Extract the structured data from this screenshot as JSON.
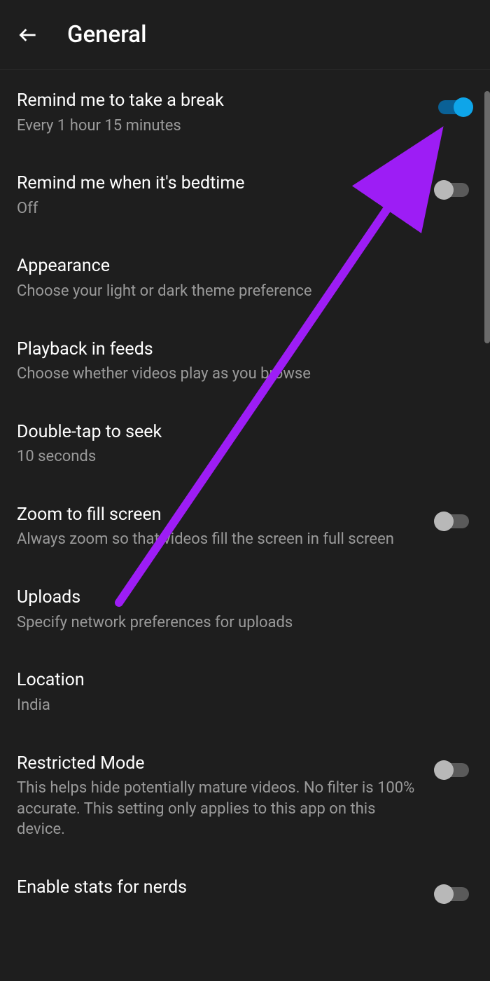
{
  "header": {
    "title": "General"
  },
  "settings": [
    {
      "title": "Remind me to take a break",
      "subtitle": "Every 1 hour 15 minutes",
      "toggle": "on"
    },
    {
      "title": "Remind me when it's bedtime",
      "subtitle": "Off",
      "toggle": "off"
    },
    {
      "title": "Appearance",
      "subtitle": "Choose your light or dark theme preference",
      "toggle": null
    },
    {
      "title": "Playback in feeds",
      "subtitle": "Choose whether videos play as you browse",
      "toggle": null
    },
    {
      "title": "Double-tap to seek",
      "subtitle": "10 seconds",
      "toggle": null
    },
    {
      "title": "Zoom to fill screen",
      "subtitle": "Always zoom so that videos fill the screen in full screen",
      "toggle": "off"
    },
    {
      "title": "Uploads",
      "subtitle": "Specify network preferences for uploads",
      "toggle": null
    },
    {
      "title": "Location",
      "subtitle": "India",
      "toggle": null
    },
    {
      "title": "Restricted Mode",
      "subtitle": "This helps hide potentially mature videos. No filter is 100% accurate. This setting only applies to this app on this device.",
      "toggle": "off"
    },
    {
      "title": "Enable stats for nerds",
      "subtitle": "",
      "toggle": "off"
    }
  ],
  "annotation": {
    "arrow_color": "#9d1df5"
  }
}
